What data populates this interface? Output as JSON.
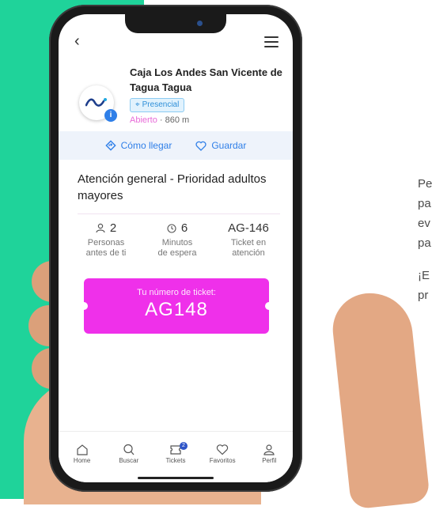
{
  "branch": {
    "name": "Caja Los Andes San Vicente de Tagua Tagua",
    "mode_badge": "Presencial",
    "status": "Abierto",
    "distance": " · 860 m"
  },
  "actions": {
    "directions": "Cómo llegar",
    "save": "Guardar"
  },
  "service": {
    "title": "Atención general - Prioridad adultos mayores"
  },
  "stats": [
    {
      "value": "2",
      "caption_1": "Personas",
      "caption_2": "antes de ti",
      "icon": "person-icon"
    },
    {
      "value": "6",
      "caption_1": "Minutos",
      "caption_2": "de espera",
      "icon": "clock-icon"
    },
    {
      "value": "AG-146",
      "caption_1": "Ticket en",
      "caption_2": "atención",
      "icon": ""
    }
  ],
  "ticket": {
    "label": "Tu número de ticket:",
    "number": "AG148"
  },
  "tabs": [
    {
      "label": "Home",
      "icon": "home-icon"
    },
    {
      "label": "Buscar",
      "icon": "search-icon"
    },
    {
      "label": "Tickets",
      "icon": "ticket-icon",
      "badge": "2"
    },
    {
      "label": "Favoritos",
      "icon": "heart-icon"
    },
    {
      "label": "Perfil",
      "icon": "profile-icon"
    }
  ],
  "side_text": {
    "line_1": "Pe",
    "line_2": "pa",
    "line_3": "ev",
    "line_4": "pa",
    "line_5": "¡E",
    "line_6": "pr"
  },
  "colors": {
    "brand_teal": "#1fd39a",
    "ticket_magenta": "#ef30ea",
    "accent_blue": "#2f7fe8"
  }
}
